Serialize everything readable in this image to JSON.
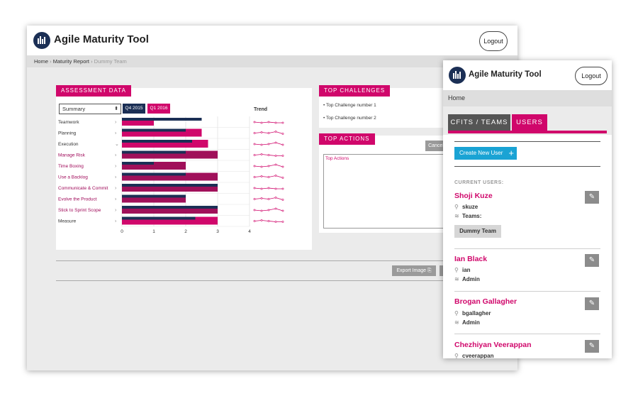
{
  "main": {
    "app_title": "Agile Maturity Tool",
    "logout": "Logout",
    "breadcrumb": {
      "home": "Home",
      "sep": "›",
      "report": "Maturity Report",
      "team": "Dummy Team"
    },
    "assessment": {
      "heading": "ASSESSMENT DATA",
      "select_value": "Summary",
      "period_1": "Q4 2015",
      "period_2": "Q1 2016",
      "trend_label": "Trend",
      "rows": [
        {
          "label": "Teamwork",
          "q4": 2.5,
          "q1": 1.0,
          "pink": false
        },
        {
          "label": "Planning",
          "q4": 2.0,
          "q1": 2.5,
          "pink": false
        },
        {
          "label": "Execution",
          "q4": 2.2,
          "q1": 2.7,
          "pink": false
        },
        {
          "label": "Manage Risk",
          "q4": 2.0,
          "q1": 3.0,
          "pink": true
        },
        {
          "label": "Time Boxing",
          "q4": 1.0,
          "q1": 2.0,
          "pink": true
        },
        {
          "label": "Use a Backlog",
          "q4": 2.0,
          "q1": 3.0,
          "pink": true
        },
        {
          "label": "Communicate & Commit",
          "q4": 3.0,
          "q1": 3.0,
          "pink": true
        },
        {
          "label": "Evolve the Product",
          "q4": 2.0,
          "q1": 2.0,
          "pink": true
        },
        {
          "label": "Stick to Sprint Scope",
          "q4": 3.0,
          "q1": 3.0,
          "pink": true
        },
        {
          "label": "Measure",
          "q4": 2.3,
          "q1": 3.0,
          "pink": false
        }
      ],
      "ticks": [
        "0",
        "1",
        "2",
        "3",
        "4"
      ]
    },
    "top_challenges": {
      "heading": "TOP CHALLENGES",
      "items": [
        "• Top Challenge number 1",
        "• Top Challenge number 2"
      ]
    },
    "top_actions": {
      "heading": "TOP ACTIONS",
      "cancel": "Cancel",
      "text": "Top Actions"
    },
    "export_label": "Export Image"
  },
  "users_window": {
    "app_title": "Agile Maturity Tool",
    "logout": "Logout",
    "breadcrumb": "Home",
    "tabs": [
      "CFITS / TEAMS",
      "USERS"
    ],
    "create_label": "Create New User",
    "current_users": "CURRENT USERS:",
    "teams_label": "Teams:",
    "users": [
      {
        "name": "Shoji Kuze",
        "login": "skuze",
        "role": "Teams:",
        "team": "Dummy Team"
      },
      {
        "name": "Ian Black",
        "login": "ian",
        "role": "Admin"
      },
      {
        "name": "Brogan Gallagher",
        "login": "bgallagher",
        "role": "Admin"
      },
      {
        "name": "Chezhiyan Veerappan",
        "login": "cveerappan"
      }
    ]
  },
  "colors": {
    "accent": "#d0076b",
    "navy": "#1b2f55",
    "create": "#1aa3d4"
  }
}
